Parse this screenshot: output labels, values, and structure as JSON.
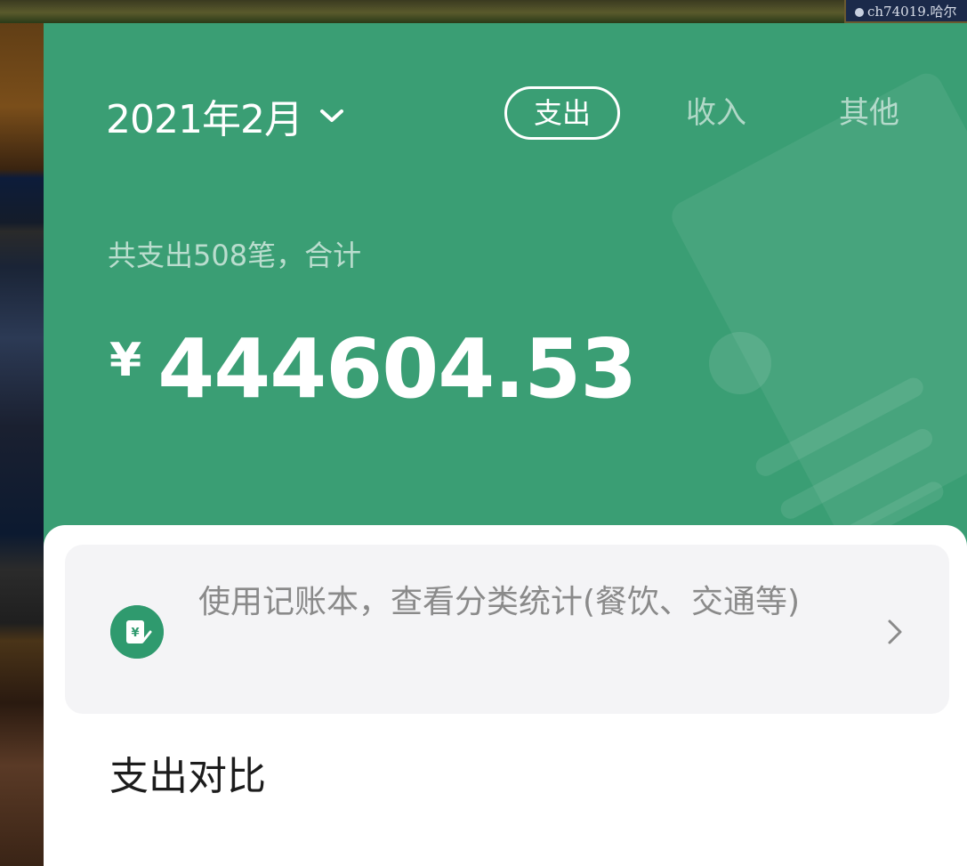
{
  "background": {
    "badge_text": "ch74019.哈尔"
  },
  "header": {
    "month": "2021年2月",
    "tabs": {
      "expense": "支出",
      "income": "收入",
      "other": "其他"
    },
    "summary": "共支出508笔，合计",
    "currency_symbol": "¥",
    "total_amount": "444604.53"
  },
  "ledger_banner": {
    "text": "使用记账本，查看分类统计(餐饮、交通等)"
  },
  "section": {
    "title": "支出对比"
  },
  "colors": {
    "header_green": "#3a9e74",
    "icon_green": "#2f9a6e",
    "banner_bg": "#f4f4f6"
  }
}
